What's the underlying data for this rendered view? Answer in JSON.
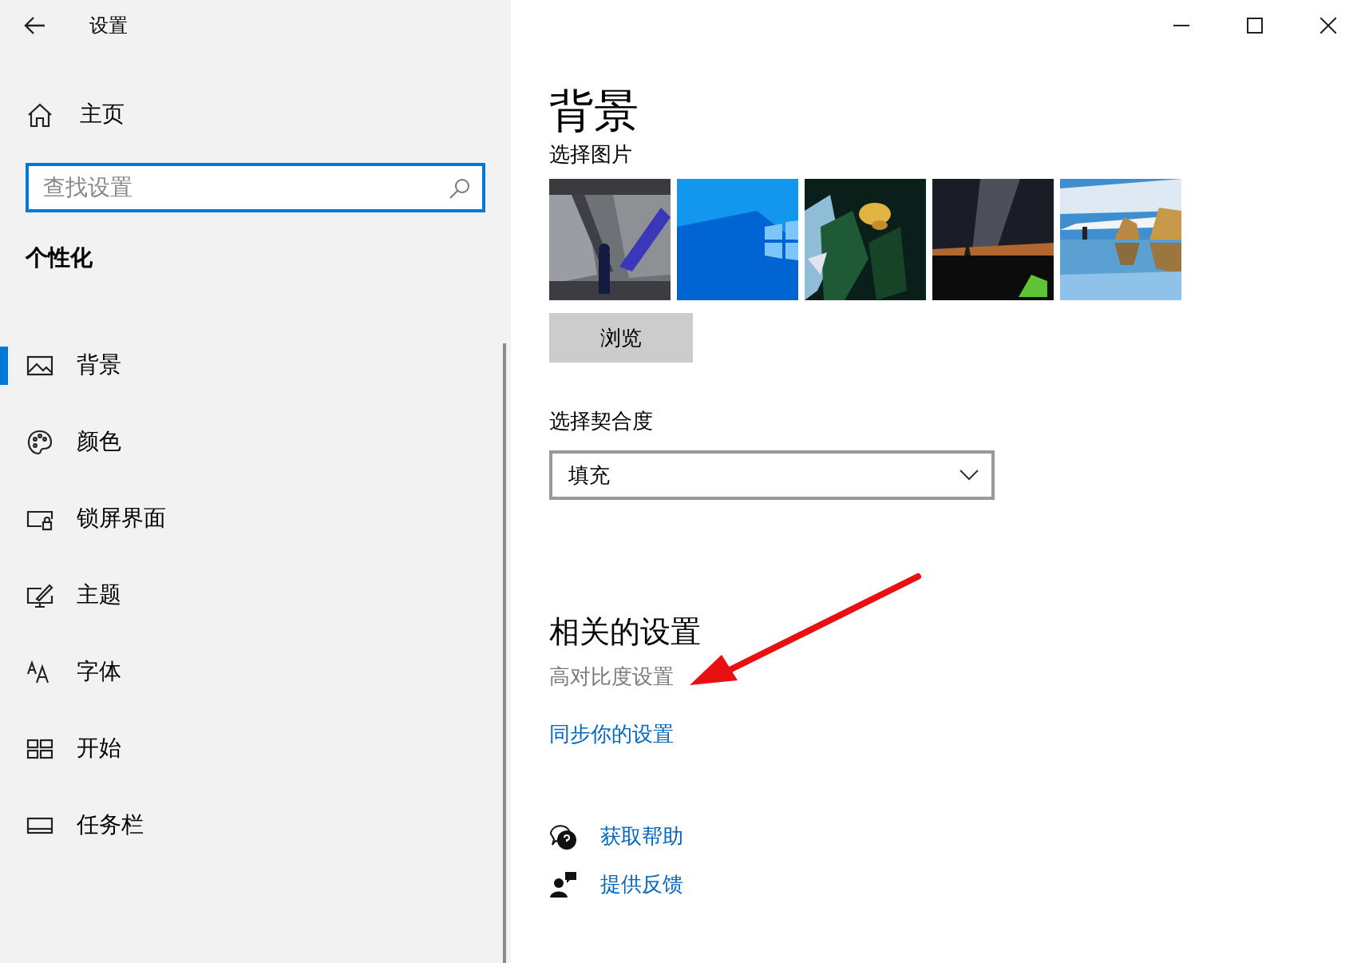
{
  "window": {
    "title": "设置"
  },
  "sidebar": {
    "home": "主页",
    "search": {
      "placeholder": "查找设置"
    },
    "section": "个性化",
    "items": [
      {
        "label": "背景",
        "selected": true
      },
      {
        "label": "颜色",
        "selected": false
      },
      {
        "label": "锁屏界面",
        "selected": false
      },
      {
        "label": "主题",
        "selected": false
      },
      {
        "label": "字体",
        "selected": false
      },
      {
        "label": "开始",
        "selected": false
      },
      {
        "label": "任务栏",
        "selected": false
      }
    ]
  },
  "content": {
    "title": "背景",
    "pictures_label": "选择图片",
    "browse_button": "浏览",
    "fit_label": "选择契合度",
    "fit_dropdown": {
      "value": "填充"
    },
    "related": {
      "title": "相关的设置",
      "links": [
        {
          "label": "高对比度设置",
          "disabled": true
        },
        {
          "label": "同步你的设置",
          "disabled": false
        }
      ]
    },
    "help": [
      {
        "label": "获取帮助"
      },
      {
        "label": "提供反馈"
      }
    ]
  }
}
